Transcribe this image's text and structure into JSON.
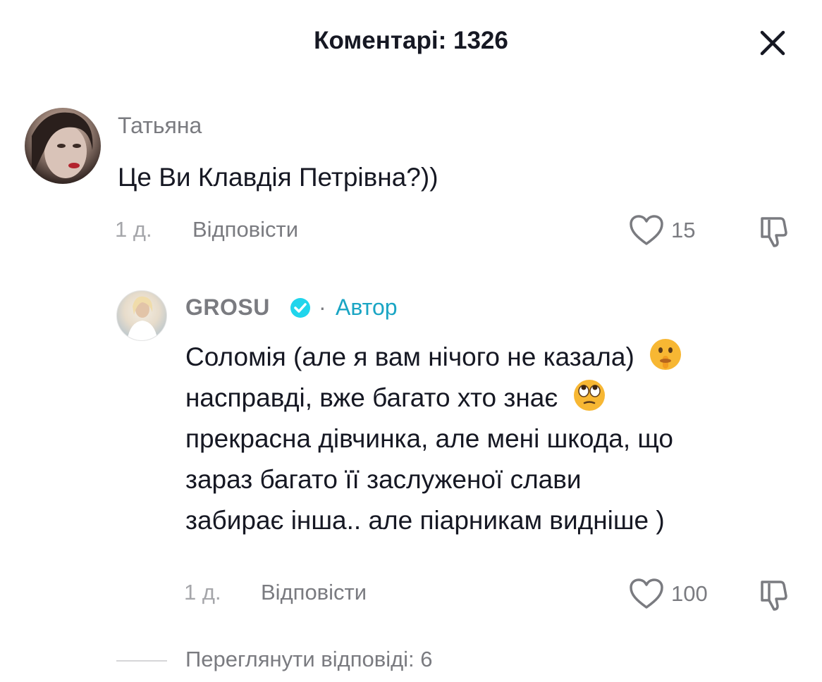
{
  "header": {
    "title": "Коментарі: 1326",
    "close_icon": "close-icon"
  },
  "comments": [
    {
      "username": "Татьяна",
      "text": "Це Ви Клавдія Петрівна?))",
      "time": "1 д.",
      "reply_label": "Відповісти",
      "likes": "15",
      "avatar_icon": "avatar-photo"
    }
  ],
  "reply": {
    "username": "GROSU",
    "verified_icon": "verified-badge-icon",
    "separator": "·",
    "author_label": "Автор",
    "lines": [
      "Соломія (але я вам нічого не казала)",
      "насправді, вже багато хто знає",
      "прекрасна дівчинка, але мені шкода, що",
      "зараз багато її заслуженої слави",
      "забирає інша.. але піарникам видніше )"
    ],
    "emojis": [
      "shushing-face-emoji",
      "face-with-rolling-eyes-emoji"
    ],
    "time": "1 д.",
    "reply_label": "Відповісти",
    "likes": "100"
  },
  "view_replies": {
    "label": "Переглянути відповіді: 6"
  },
  "colors": {
    "text_primary": "#161823",
    "text_secondary": "#7a7b80",
    "text_muted": "#a5a6aa",
    "author_accent": "#1aa5c4",
    "verified": "#20d5ec"
  }
}
